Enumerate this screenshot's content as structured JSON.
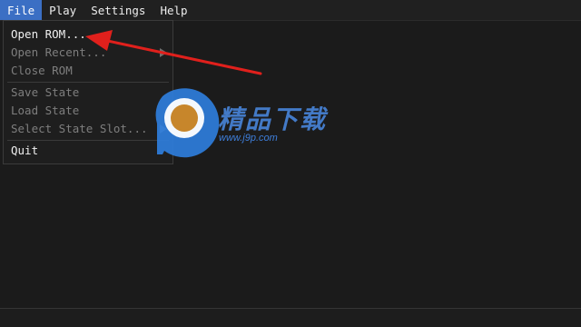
{
  "menubar": {
    "items": [
      "File",
      "Play",
      "Settings",
      "Help"
    ],
    "active": "File"
  },
  "file_menu": {
    "items": [
      {
        "label": "Open ROM...",
        "enabled": true
      },
      {
        "label": "Open Recent...",
        "enabled": false,
        "submenu": true
      },
      {
        "label": "Close ROM",
        "enabled": false
      },
      {
        "label": "Save State",
        "enabled": false
      },
      {
        "label": "Load State",
        "enabled": false
      },
      {
        "label": "Select State Slot...",
        "enabled": false,
        "submenu": true
      },
      {
        "label": "Quit",
        "enabled": true
      }
    ]
  },
  "watermark": {
    "brand": "精品下载",
    "url": "www.j9p.com"
  },
  "annotation": {
    "arrow_color": "#e0201c"
  },
  "colors": {
    "menu_highlight": "#3b6fc4",
    "background": "#1b1b1b"
  }
}
